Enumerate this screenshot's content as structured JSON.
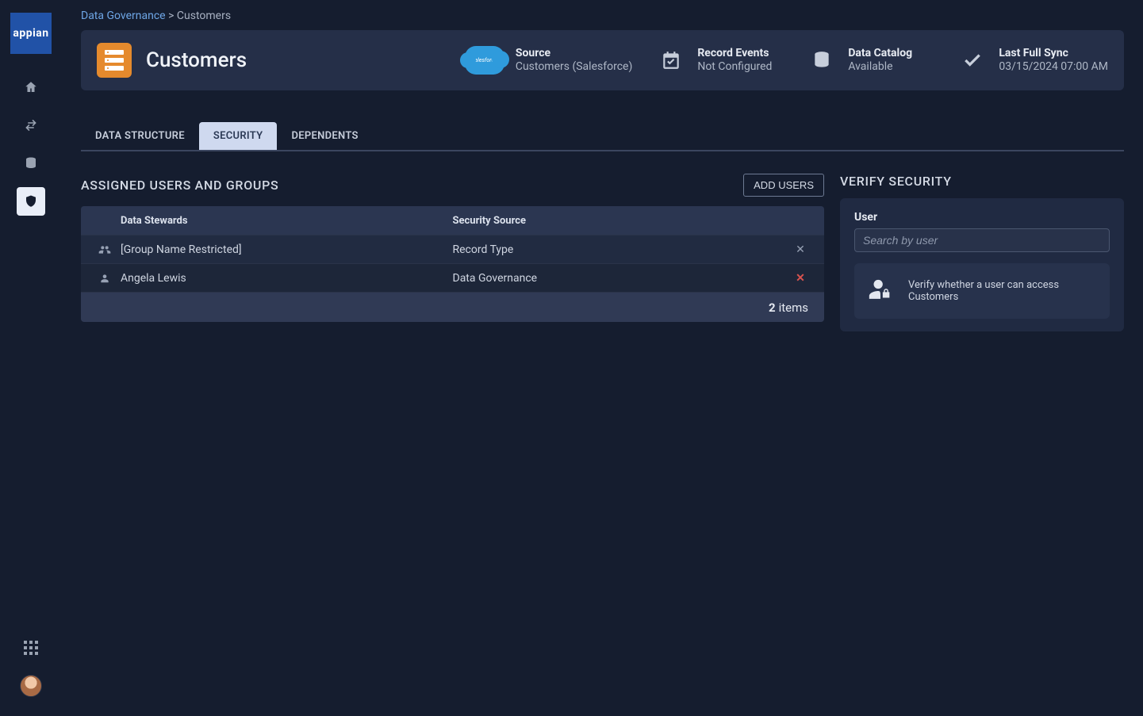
{
  "logo_text": "appian",
  "breadcrumb": {
    "root": "Data Governance",
    "separator": ">",
    "current": "Customers"
  },
  "page_title": "Customers",
  "meta": {
    "source": {
      "label": "Source",
      "value": "Customers (Salesforce)"
    },
    "record_events": {
      "label": "Record Events",
      "value": "Not Configured"
    },
    "data_catalog": {
      "label": "Data Catalog",
      "value": "Available"
    },
    "last_sync": {
      "label": "Last Full Sync",
      "value": "03/15/2024 07:00 AM"
    }
  },
  "tabs": [
    {
      "id": "data_structure",
      "label": "DATA STRUCTURE",
      "active": false
    },
    {
      "id": "security",
      "label": "SECURITY",
      "active": true
    },
    {
      "id": "dependents",
      "label": "DEPENDENTS",
      "active": false
    }
  ],
  "assigned_section_title": "ASSIGNED USERS AND GROUPS",
  "add_users_label": "ADD USERS",
  "table": {
    "columns": {
      "stewards": "Data Stewards",
      "source": "Security Source"
    },
    "rows": [
      {
        "icon": "group",
        "steward": "[Group Name Restricted]",
        "source": "Record Type",
        "removable": false
      },
      {
        "icon": "user",
        "steward": "Angela Lewis",
        "source": "Data Governance",
        "removable": true
      }
    ],
    "footer": {
      "count": "2",
      "items_word": "items"
    }
  },
  "verify": {
    "title": "VERIFY SECURITY",
    "field_label": "User",
    "placeholder": "Search by user",
    "hint": "Verify whether a user can access Customers"
  }
}
